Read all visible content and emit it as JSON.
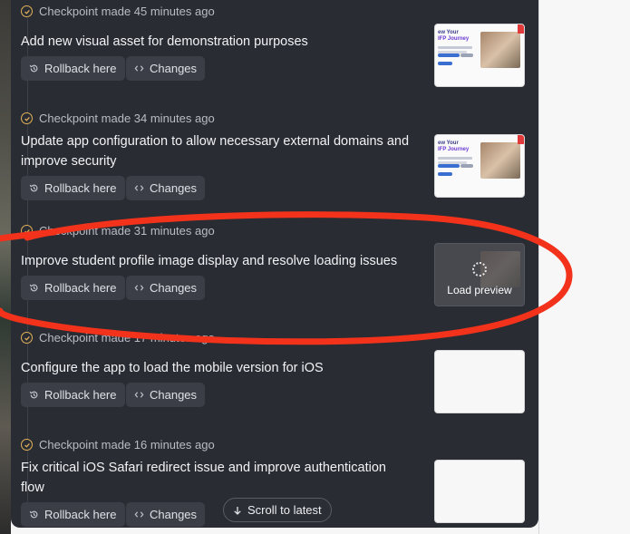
{
  "checkpoints": [
    {
      "meta": "Checkpoint made 45 minutes ago",
      "title": "Add new visual asset for demonstration purposes",
      "rollback_label": "Rollback here",
      "changes_label": "Changes",
      "preview": "thumbnail",
      "thumb_text_1": "ew Your",
      "thumb_text_2": "IFP Journey"
    },
    {
      "meta": "Checkpoint made 34 minutes ago",
      "title": "Update app configuration to allow necessary external domains and improve security",
      "rollback_label": "Rollback here",
      "changes_label": "Changes",
      "preview": "thumbnail",
      "thumb_text_1": "ew Your",
      "thumb_text_2": "IFP Journey"
    },
    {
      "meta": "Checkpoint made 31 minutes ago",
      "title": "Improve student profile image display and resolve loading issues",
      "rollback_label": "Rollback here",
      "changes_label": "Changes",
      "preview": "load",
      "load_label": "Load preview"
    },
    {
      "meta": "Checkpoint made 17 minutes ago",
      "title": "Configure the app to load the mobile version for iOS",
      "rollback_label": "Rollback here",
      "changes_label": "Changes",
      "preview": "blank"
    },
    {
      "meta": "Checkpoint made 16 minutes ago",
      "title": "Fix critical iOS Safari redirect issue and improve authentication flow",
      "rollback_label": "Rollback here",
      "changes_label": "Changes",
      "preview": "blank"
    }
  ],
  "scroll_to_latest": "Scroll to latest",
  "colors": {
    "panel_bg": "#2a2c33",
    "button_bg": "#3b3e47",
    "checkmark": "#e2b25a",
    "annotation_red": "#f2321b"
  },
  "icons": {
    "check": "check-circle-icon",
    "rollback": "history-icon",
    "changes": "code-icon",
    "scroll": "arrow-down-icon",
    "loading": "spinner-icon"
  }
}
